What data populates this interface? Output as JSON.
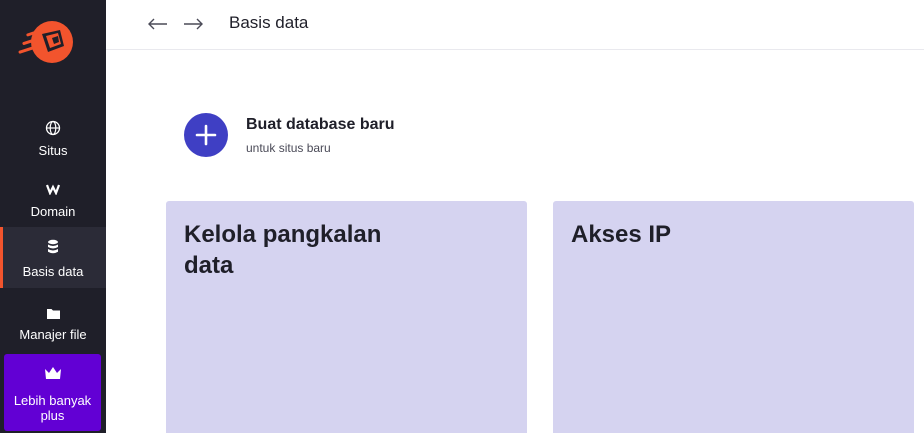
{
  "colors": {
    "sidebar_bg": "#1f1f29",
    "accent": "#f2542d",
    "upgrade_bg": "#6200d4",
    "create_circle": "#3f3fc4",
    "card_bg": "#d5d3f0"
  },
  "sidebar": {
    "logo": "hostinger-rocket-logo",
    "items": [
      {
        "label": "Situs",
        "icon": "globe-icon"
      },
      {
        "label": "Domain",
        "icon": "www-icon"
      },
      {
        "label": "Basis data",
        "icon": "database-icon",
        "active": true
      },
      {
        "label": "Manajer file",
        "icon": "folder-icon"
      }
    ],
    "upgrade": {
      "label": "Lebih banyak plus",
      "icon": "crown-icon"
    }
  },
  "topbar": {
    "back_icon": "arrow-left-icon",
    "forward_icon": "arrow-right-icon",
    "title": "Basis data"
  },
  "create": {
    "icon": "plus-icon",
    "title": "Buat database baru",
    "subtitle": "untuk situs baru"
  },
  "cards": [
    {
      "title": "Kelola pangkalan data"
    },
    {
      "title": "Akses IP"
    }
  ]
}
